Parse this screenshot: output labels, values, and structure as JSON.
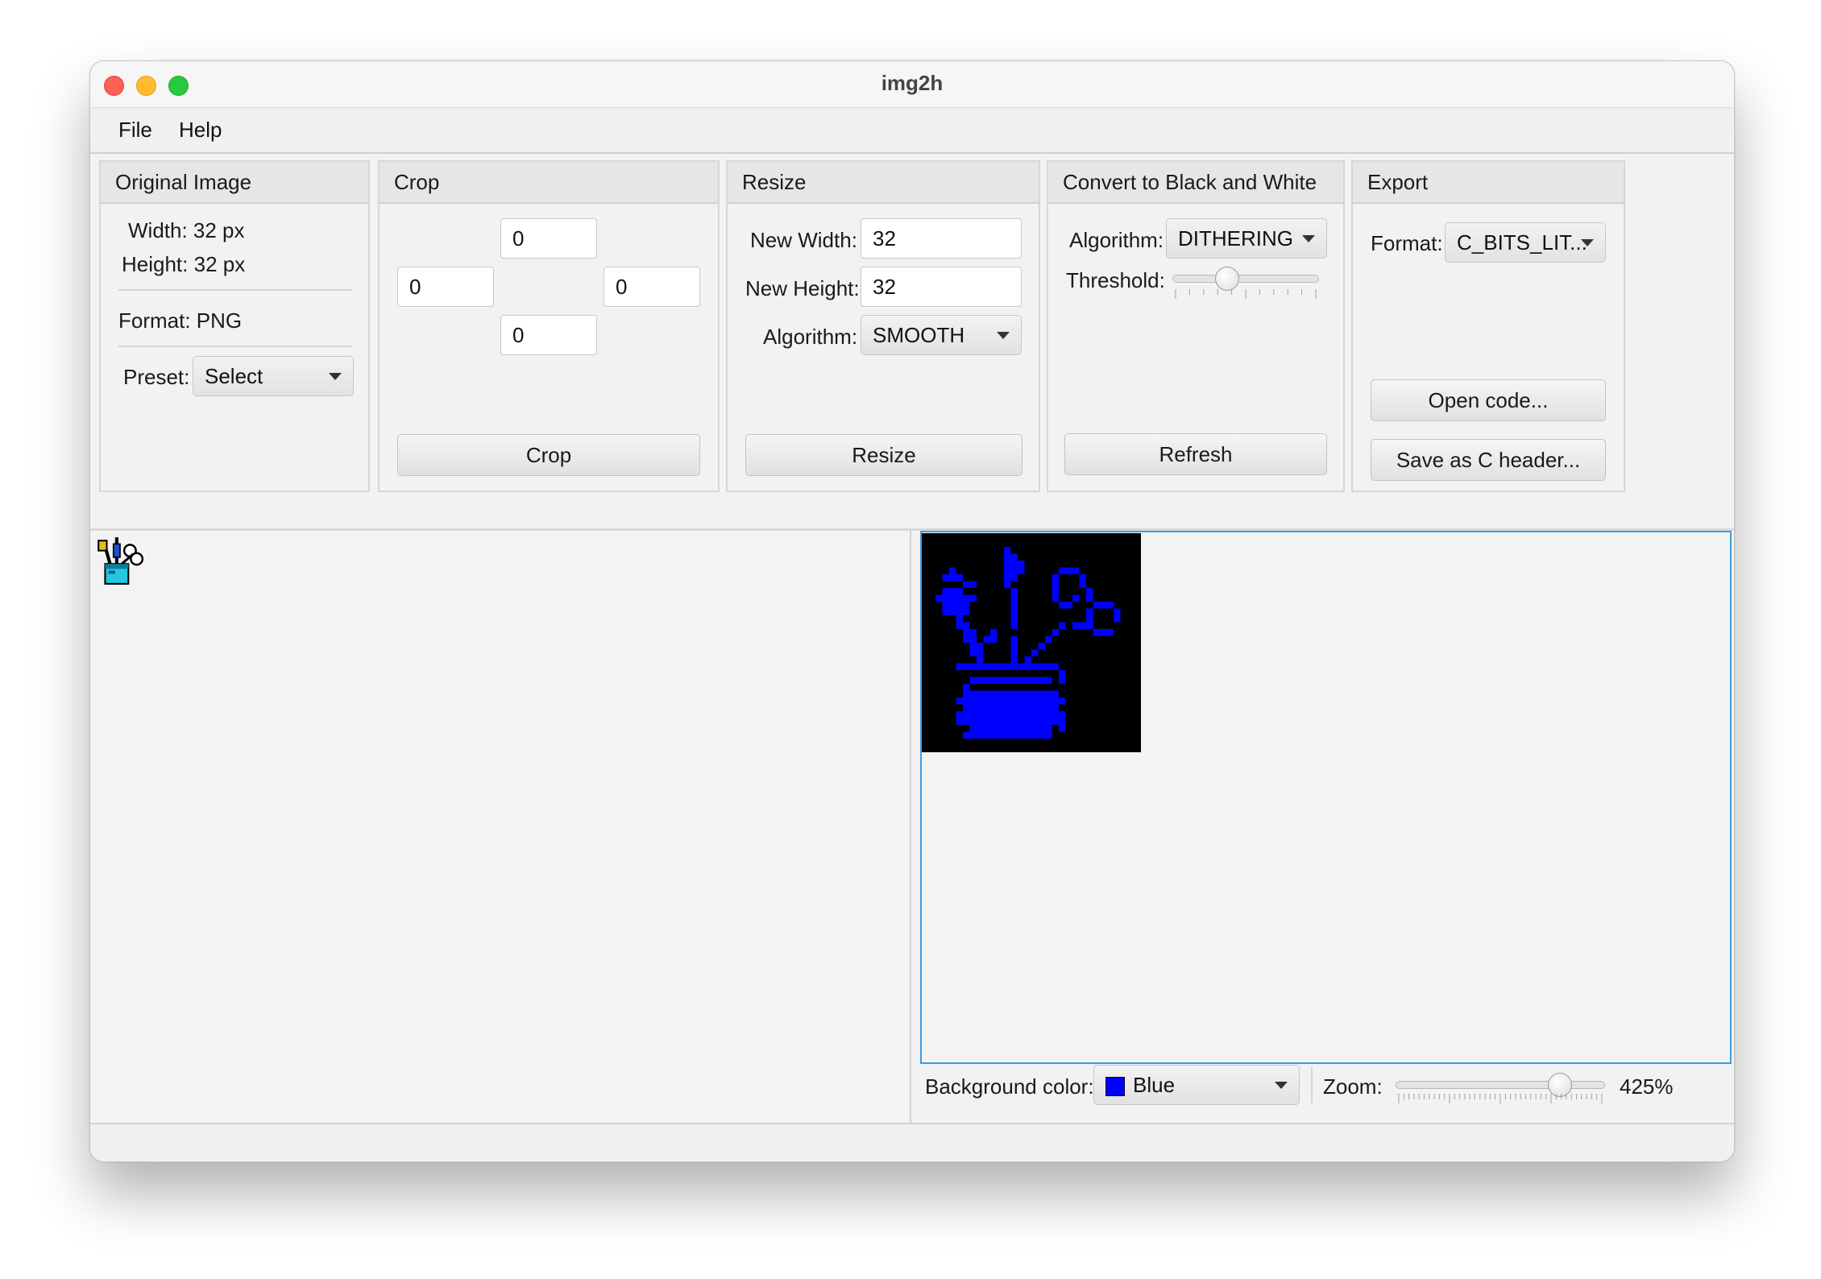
{
  "window": {
    "title": "img2h"
  },
  "menu": {
    "items": [
      "File",
      "Help"
    ]
  },
  "original": {
    "header": "Original Image",
    "width": "Width: 32 px",
    "height": "Height: 32 px",
    "format": "Format: PNG",
    "preset_label": "Preset:",
    "preset_value": "Select"
  },
  "crop": {
    "header": "Crop",
    "top": "0",
    "left": "0",
    "right": "0",
    "bottom": "0",
    "button": "Crop"
  },
  "resize": {
    "header": "Resize",
    "width_label": "New Width:",
    "width_value": "32",
    "height_label": "New Height:",
    "height_value": "32",
    "algorithm_label": "Algorithm:",
    "algorithm_value": "SMOOTH",
    "button": "Resize"
  },
  "bw": {
    "header": "Convert to Black and White",
    "algorithm_label": "Algorithm:",
    "algorithm_value": "DITHERING",
    "threshold_label": "Threshold:",
    "threshold_level": 0.35,
    "button": "Refresh"
  },
  "export": {
    "header": "Export",
    "format_label": "Format:",
    "format_value": "C_BITS_LIT...",
    "open_button": "Open code...",
    "save_button": "Save as C header..."
  },
  "preview": {
    "bg_label": "Background color:",
    "bg_value": "Blue",
    "bg_color": "#0000ff",
    "zoom_label": "Zoom:",
    "zoom_value": "425%",
    "zoom_level": 0.82
  },
  "colors": {
    "accent": "#3d9de0",
    "pixel_on": "#0000ff",
    "pixel_off": "#000000"
  }
}
